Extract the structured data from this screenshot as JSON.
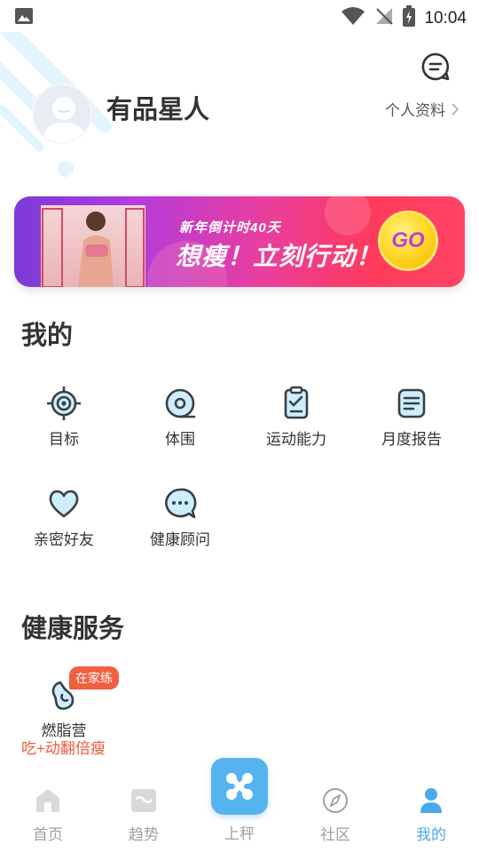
{
  "status_bar": {
    "time": "10:04"
  },
  "header": {
    "username": "有品星人",
    "profile_link": "个人资料"
  },
  "banner": {
    "subtitle": "新年倒计时40天",
    "headline": "想瘦！立刻行动！",
    "go_label": "GO"
  },
  "my_section": {
    "title": "我的",
    "items": [
      {
        "label": "目标",
        "icon": "target-icon"
      },
      {
        "label": "体围",
        "icon": "tape-measure-icon"
      },
      {
        "label": "运动能力",
        "icon": "clipboard-check-icon"
      },
      {
        "label": "月度报告",
        "icon": "report-icon"
      },
      {
        "label": "亲密好友",
        "icon": "heart-icon"
      },
      {
        "label": "健康顾问",
        "icon": "chat-bubble-icon"
      }
    ]
  },
  "health_section": {
    "title": "健康服务",
    "service": {
      "badge": "在家练",
      "label": "燃脂营",
      "subtitle": "吃+动翻倍瘦",
      "icon": "fat-burn-icon"
    }
  },
  "bottom_nav": {
    "items": [
      {
        "label": "首页",
        "icon": "home-icon"
      },
      {
        "label": "趋势",
        "icon": "trend-icon"
      },
      {
        "label": "上秤",
        "icon": "scale-icon"
      },
      {
        "label": "社区",
        "icon": "compass-icon"
      },
      {
        "label": "我的",
        "icon": "person-icon",
        "active": true
      }
    ]
  },
  "colors": {
    "accent": "#4aa9ea",
    "icon_fill": "#cdeefc",
    "icon_stroke": "#3a3f47",
    "badge": "#f0603e"
  }
}
